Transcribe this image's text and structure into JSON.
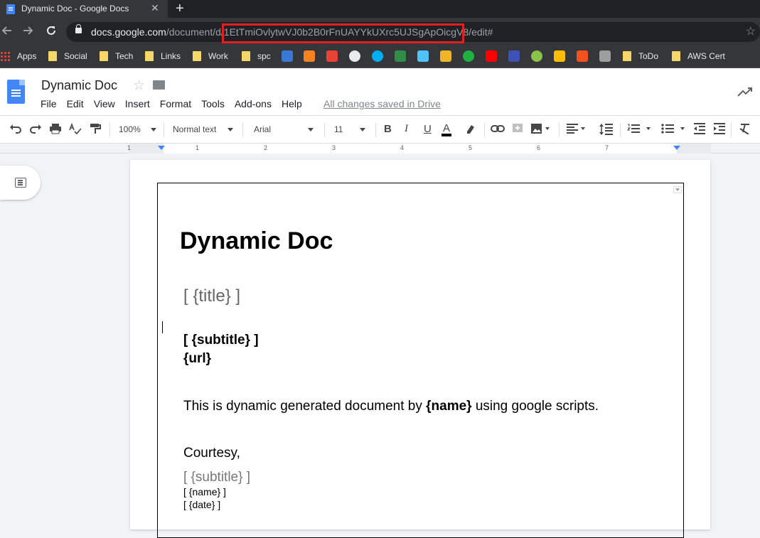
{
  "browser": {
    "tab_title": "Dynamic Doc - Google Docs",
    "tab_close": "✕",
    "new_tab": "+",
    "url_host": "docs.google.com",
    "url_path_prefix": "/document/d/",
    "url_doc_id": "1EtTmiOvlytwVJ0b2B0rFnUAYYkUXrc5UJSgApOicgV8",
    "url_suffix": "/edit#"
  },
  "bookmarks": [
    {
      "label": "Apps"
    },
    {
      "label": "Social"
    },
    {
      "label": "Tech"
    },
    {
      "label": "Links"
    },
    {
      "label": "Work"
    },
    {
      "label": "spc"
    },
    {
      "label": "ToDo"
    },
    {
      "label": "AWS Cert"
    }
  ],
  "bookmark_icon_colors": [
    "#3a78d6",
    "#f58220",
    "#ea4335",
    "#e8eaed",
    "#00aff0",
    "#2f8d46",
    "#4fc3f7",
    "#f0b429",
    "#1fb141",
    "#ff0000",
    "#3f51b5",
    "#8bc34a",
    "#fbbc04",
    "#f4511e",
    "#9e9e9e"
  ],
  "docs": {
    "title": "Dynamic Doc",
    "menus": [
      "File",
      "Edit",
      "View",
      "Insert",
      "Format",
      "Tools",
      "Add-ons",
      "Help"
    ],
    "saved_status": "All changes saved in Drive"
  },
  "toolbar": {
    "zoom": "100%",
    "style": "Normal text",
    "font": "Arial",
    "size": "11",
    "bold": "B",
    "italic": "I",
    "underline": "U",
    "text_color": "A"
  },
  "ruler_numbers": [
    "1",
    "1",
    "2",
    "3",
    "4",
    "5",
    "6",
    "7"
  ],
  "document": {
    "heading": "Dynamic Doc",
    "title_placeholder": "[ {title} ]",
    "subtitle_placeholder": "[ {subtitle} ]",
    "url_placeholder": "{url}",
    "body_before": "This is dynamic generated document by ",
    "body_bold": "{name}",
    "body_after": " using google scripts.",
    "courtesy": "Courtesy,",
    "subtitle2": "[ {subtitle} ]",
    "name_line": "[ {name} ]",
    "date_line": "[ {date} ]"
  }
}
